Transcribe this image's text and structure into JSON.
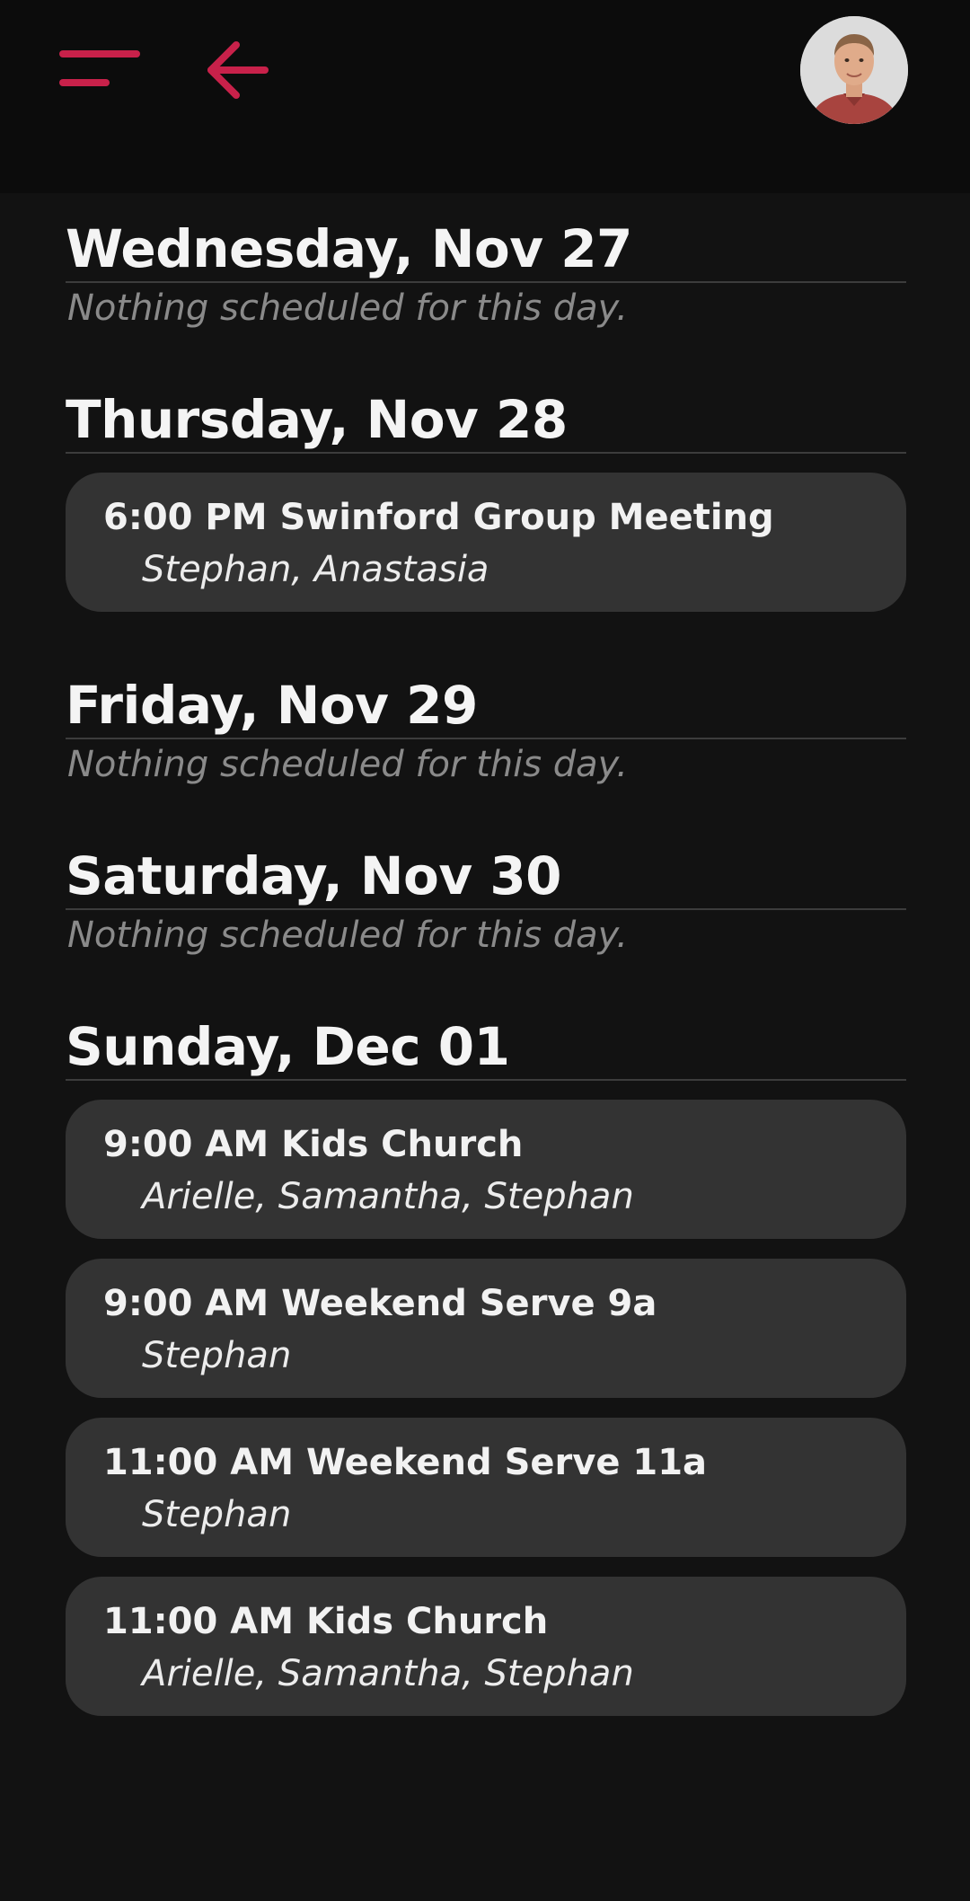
{
  "colors": {
    "accent": "#c8214a",
    "background": "#121212",
    "header": "#0c0c0c",
    "card": "#333333",
    "muted_text": "#8a8a8a"
  },
  "header": {
    "menu_icon": "hamburger-menu-icon",
    "back_icon": "arrow-left-icon",
    "avatar_icon": "user-avatar"
  },
  "days": [
    {
      "title": "Wednesday, Nov 27",
      "empty_text": "Nothing scheduled for this day."
    },
    {
      "title": "Thursday, Nov 28",
      "events": [
        {
          "title": "6:00 PM Swinford Group Meeting",
          "people": "Stephan, Anastasia"
        }
      ]
    },
    {
      "title": "Friday, Nov 29",
      "empty_text": "Nothing scheduled for this day."
    },
    {
      "title": "Saturday, Nov 30",
      "empty_text": "Nothing scheduled for this day."
    },
    {
      "title": "Sunday, Dec 01",
      "events": [
        {
          "title": "9:00 AM Kids Church",
          "people": "Arielle, Samantha, Stephan"
        },
        {
          "title": "9:00 AM Weekend Serve 9a",
          "people": "Stephan"
        },
        {
          "title": "11:00 AM Weekend Serve 11a",
          "people": "Stephan"
        },
        {
          "title": "11:00 AM Kids Church",
          "people": "Arielle, Samantha, Stephan"
        }
      ]
    }
  ]
}
